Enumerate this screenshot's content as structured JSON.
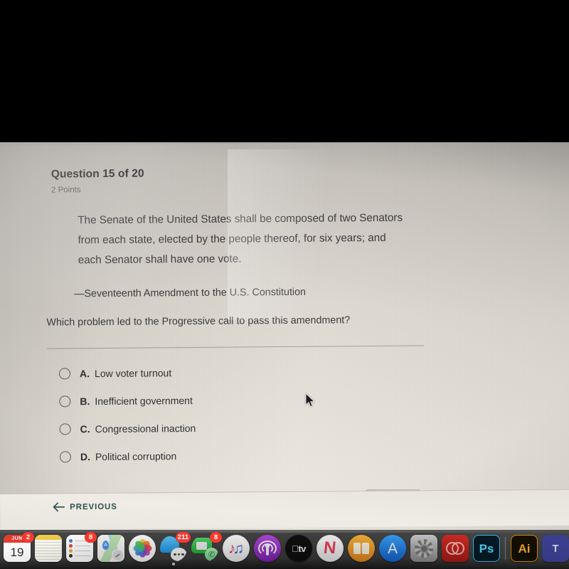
{
  "quiz": {
    "question_header": "Question 15 of 20",
    "points": "2 Points",
    "quote": "The Senate of the United States shall be composed of two Senators from each state, elected by the people thereof, for six years; and each Senator shall have one vote.",
    "attribution": "—Seventeenth Amendment to the U.S. Constitution",
    "prompt": "Which problem led to the Progressive call to pass this amendment?",
    "options": [
      {
        "letter": "A.",
        "text": "Low voter turnout",
        "selected": false
      },
      {
        "letter": "B.",
        "text": "Inefficient government",
        "selected": false
      },
      {
        "letter": "C.",
        "text": "Congressional inaction",
        "selected": false
      },
      {
        "letter": "D.",
        "text": "Political corruption",
        "selected": false
      }
    ]
  },
  "nav": {
    "previous_label": "PREVIOUS",
    "previous_icon": "arrow-left-icon",
    "accent_color": "#2f4f50"
  },
  "colors": {
    "page_background": "#e8e4dc",
    "text_primary": "#2e2e2e",
    "text_secondary": "#5b5b5b",
    "badge_red": "#f43a2f",
    "dock_background": "#3e3e3e"
  },
  "dock": {
    "items": [
      {
        "name": "calendar",
        "label": "Calendar",
        "badge": "2",
        "month": "JUN",
        "day": "19",
        "running": false
      },
      {
        "name": "notes",
        "label": "Notes",
        "badge": "",
        "running": false
      },
      {
        "name": "reminders",
        "label": "Reminders",
        "badge": "8",
        "running": false
      },
      {
        "name": "maps",
        "label": "Maps",
        "badge": "",
        "running": false
      },
      {
        "name": "photos",
        "label": "Photos",
        "badge": "",
        "running": false
      },
      {
        "name": "messages",
        "label": "Messages",
        "badge": "211",
        "running": true
      },
      {
        "name": "facetime",
        "label": "FaceTime",
        "badge": "8",
        "running": false
      },
      {
        "name": "music",
        "label": "Music",
        "badge": "",
        "running": false
      },
      {
        "name": "podcasts",
        "label": "Podcasts",
        "badge": "",
        "running": false
      },
      {
        "name": "apple-tv",
        "label": "tv",
        "badge": "",
        "running": false
      },
      {
        "name": "news",
        "label": "News",
        "badge": "",
        "running": false
      },
      {
        "name": "books",
        "label": "Books",
        "badge": "",
        "running": false
      },
      {
        "name": "app-store",
        "label": "App Store",
        "badge": "",
        "running": false
      },
      {
        "name": "system-preferences",
        "label": "System Preferences",
        "badge": "",
        "running": false
      },
      {
        "name": "creative-cloud",
        "label": "Creative Cloud",
        "badge": "",
        "running": false
      },
      {
        "name": "photoshop",
        "label": "Ps",
        "badge": "",
        "running": false
      },
      {
        "name": "illustrator",
        "label": "Ai",
        "badge": "",
        "running": false
      },
      {
        "name": "tool-app",
        "label": "T",
        "badge": "",
        "running": false
      }
    ]
  }
}
